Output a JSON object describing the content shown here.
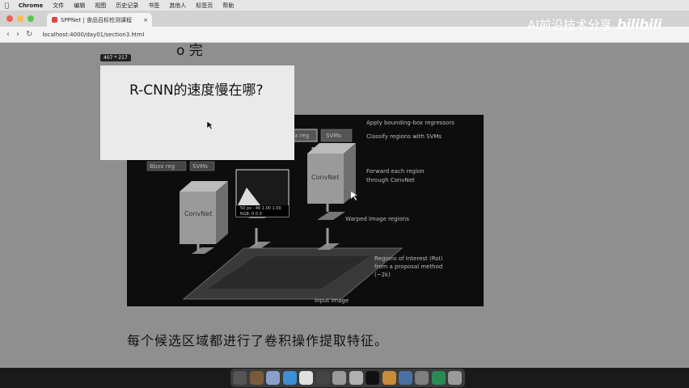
{
  "menubar": {
    "app_name": "Chrome",
    "items": [
      "文件",
      "编辑",
      "视图",
      "历史记录",
      "书签",
      "其他人",
      "标签页",
      "帮助"
    ]
  },
  "browser": {
    "tab_title": "SPPNet | 食品目标检测课程",
    "tab_close": "×",
    "url": "localhost:4000/day01/section3.html",
    "nav": {
      "back": "‹",
      "forward": "›",
      "reload": "↻"
    },
    "traffic_lights": [
      "#ec5f57",
      "#f5be4f",
      "#5fc452"
    ]
  },
  "page": {
    "bullet_fragment": "o 完",
    "dimension_badge": "407 * 217",
    "slide_heading": "R-CNN的速度慢在哪?",
    "caption": "每个候选区域都进行了卷积操作提取特征。"
  },
  "diagram": {
    "labels": {
      "apply_bbox": "Apply bounding-box regressors",
      "classify": "Classify regions with SVMs",
      "forward": "Forward each region",
      "through": "through ConvNet",
      "warped": "Warped image regions",
      "roi1": "Regions of Interest (RoI)",
      "roi2": "from a proposal method",
      "roi3": "(~2k)",
      "input": "Input image",
      "bbox_reg": "Bbox reg",
      "svms": "SVMs",
      "convnet": "ConvNet",
      "zoom_info1": "50 px · 46 1.00 1.00",
      "zoom_info2": "RGB: 0  0  0"
    }
  },
  "watermark": {
    "text": "AI前沿技术分享",
    "brand": "bilibili"
  },
  "dock": {
    "icon_colors": [
      "#555555",
      "#7a5a3a",
      "#8aa0c8",
      "#3d8fd6",
      "#e0e0e0",
      "#444444",
      "#9a9a9a",
      "#b0b0b0",
      "#111111",
      "#c98b3a",
      "#4a6fa5",
      "#7f7f7f",
      "#2a8a55",
      "#9a9a9a"
    ]
  }
}
